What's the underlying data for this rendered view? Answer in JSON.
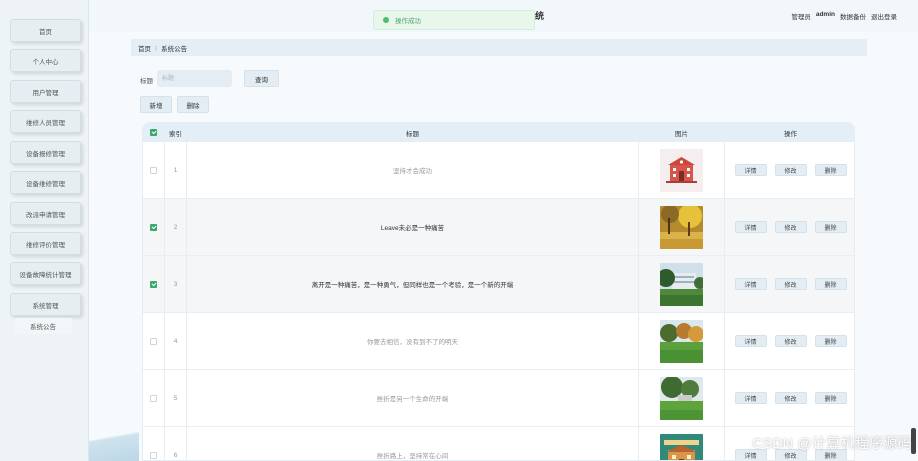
{
  "sidebar": {
    "items": [
      "首页",
      "个人中心",
      "用户管理",
      "维修人员管理",
      "设备报修管理",
      "设备维修管理",
      "改派申请管理",
      "维修评价管理",
      "设备故障统计管理",
      "系统管理"
    ],
    "subitem": "系统公告"
  },
  "header": {
    "title_fragment": "统",
    "toast": "操作成功",
    "user_role": "管理员",
    "user_name": "admin",
    "backup": "数据备份",
    "logout": "退出登录"
  },
  "breadcrumb": {
    "home": "首页",
    "sep": "⁝",
    "current": "系统公告"
  },
  "search": {
    "label": "标题",
    "placeholder": "标题",
    "button": "查询"
  },
  "toolbar": {
    "add": "新增",
    "delete": "删除"
  },
  "table": {
    "headers": {
      "index": "索引",
      "title": "标题",
      "image": "图片",
      "actions": "操作"
    },
    "actions": {
      "detail": "详情",
      "edit": "修改",
      "delete": "删除"
    },
    "rows": [
      {
        "index": "1",
        "title": "坚持才会成功",
        "checked": false,
        "image": "school-building-icon"
      },
      {
        "index": "2",
        "title": "Leave未必是一种痛苦",
        "checked": true,
        "image": "autumn-tree-photo"
      },
      {
        "index": "3",
        "title": "离开是一种痛苦，是一种勇气，但同样也是一个考验，是一个新的开端",
        "checked": true,
        "image": "campus-building-photo"
      },
      {
        "index": "4",
        "title": "你要去相信，没有到不了的明天",
        "checked": false,
        "image": "lawn-trees-photo"
      },
      {
        "index": "5",
        "title": "挫折是另一个生命的开端",
        "checked": false,
        "image": "campus-lawn-photo"
      },
      {
        "index": "6",
        "title": "挫折路上，坚持常在心间",
        "checked": false,
        "image": "school-illustration-photo"
      }
    ]
  },
  "watermark": "CSDN @计算机程序源码",
  "colors": {
    "accent": "#3aa76d",
    "header_bg": "#e3eef7",
    "button_bg": "#e3edf3"
  }
}
